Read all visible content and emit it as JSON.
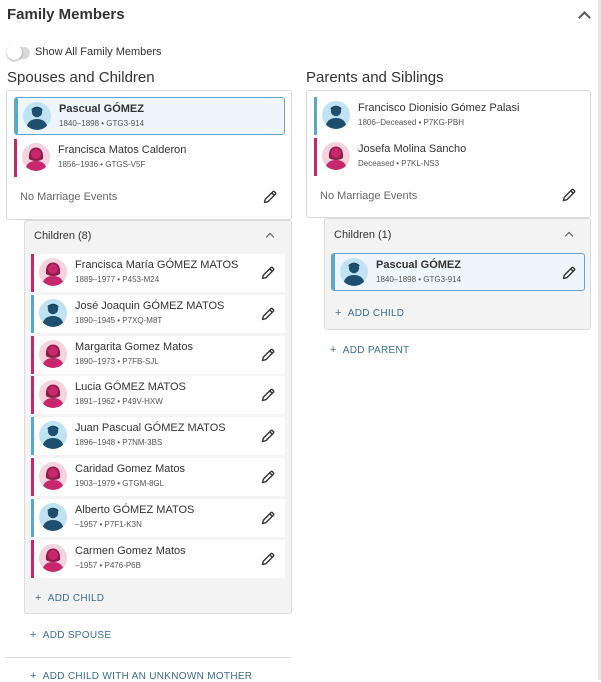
{
  "panel": {
    "title": "Family Members",
    "toggle_label": "Show All Family Members"
  },
  "spouses": {
    "title": "Spouses and Children",
    "persons": [
      {
        "name": "Pascual GÓMEZ",
        "meta": "1840–1898 • GTG3-914",
        "gender": "male",
        "highlight": true
      },
      {
        "name": "Francisca Matos Calderon",
        "meta": "1856–1936 • GTGS-V5F",
        "gender": "female",
        "highlight": false
      }
    ],
    "no_marriage": "No Marriage Events",
    "children_title": "Children (8)",
    "children": [
      {
        "name": "Francisca María GÓMEZ MATOS",
        "meta": "1889–1977 • P453-M24",
        "gender": "female"
      },
      {
        "name": "José Joaquin GÓMEZ MATOS",
        "meta": "1890–1945 • P7XQ-M8T",
        "gender": "male"
      },
      {
        "name": "Margarita Gomez Matos",
        "meta": "1890–1973 • P7FB-SJL",
        "gender": "female"
      },
      {
        "name": "Lucia GÓMEZ MATOS",
        "meta": "1891–1962 • P49V-HXW",
        "gender": "female"
      },
      {
        "name": "Juan Pascual GÓMEZ MATOS",
        "meta": "1896–1948 • P7NM-3BS",
        "gender": "male"
      },
      {
        "name": "Caridad Gomez Matos",
        "meta": "1903–1979 • GTGM-8GL",
        "gender": "female"
      },
      {
        "name": "Alberto GÓMEZ MATOS",
        "meta": "–1957 • P7F1-K3N",
        "gender": "male"
      },
      {
        "name": "Carmen Gomez Matos",
        "meta": "–1957 • P476-P6B",
        "gender": "female"
      }
    ],
    "add_child": "ADD CHILD",
    "add_spouse": "ADD SPOUSE",
    "add_child_unknown": "ADD CHILD WITH AN UNKNOWN MOTHER"
  },
  "parents": {
    "title": "Parents and Siblings",
    "persons": [
      {
        "name": "Francisco Dionisio Gómez Palasi",
        "meta": "1806–Deceased • P7KG-PBH",
        "gender": "male"
      },
      {
        "name": "Josefa Molina Sancho",
        "meta": "Deceased • P7KL-NS3",
        "gender": "female"
      }
    ],
    "no_marriage": "No Marriage Events",
    "children_title": "Children (1)",
    "children": [
      {
        "name": "Pascual GÓMEZ",
        "meta": "1840–1898 • GTG3-914",
        "gender": "male",
        "highlight": true
      }
    ],
    "add_child": "ADD CHILD",
    "add_parent": "ADD PARENT"
  },
  "colors": {
    "male_bar": "#5aa7c7",
    "female_bar": "#c6286b",
    "action_link": "#3a6d8c",
    "highlight_border": "#6aa3c8"
  }
}
